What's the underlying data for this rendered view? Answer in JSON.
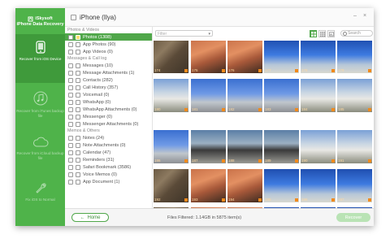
{
  "app": {
    "brand": "iSkysoft",
    "name": "iPhone Data Recovery"
  },
  "sidebar": {
    "modes": [
      {
        "label": "Recover from iOS Device",
        "icon": "phone-icon",
        "active": true
      },
      {
        "label": "Recover from iTunes backup file",
        "icon": "music-note-icon",
        "active": false
      },
      {
        "label": "Recover from iCloud backup file",
        "icon": "cloud-icon",
        "active": false
      },
      {
        "label": "Fix iOS to Normal",
        "icon": "wrench-icon",
        "active": false
      }
    ]
  },
  "header": {
    "device_title": "iPhone (Ilya)"
  },
  "categories": {
    "groups": [
      {
        "title": "Photos & Videos",
        "items": [
          {
            "label": "Photos (1308)",
            "selected": true
          },
          {
            "label": "App Photos (90)",
            "selected": false
          },
          {
            "label": "App Videos (0)",
            "selected": false
          }
        ]
      },
      {
        "title": "Messages & Call log",
        "items": [
          {
            "label": "Messages (10)",
            "selected": false
          },
          {
            "label": "Message Attachments (1)",
            "selected": false
          },
          {
            "label": "Contacts (282)",
            "selected": false
          },
          {
            "label": "Call History (357)",
            "selected": false
          },
          {
            "label": "Voicemail (0)",
            "selected": false
          },
          {
            "label": "WhatsApp (0)",
            "selected": false
          },
          {
            "label": "WhatsApp Attachments (0)",
            "selected": false
          },
          {
            "label": "Messenger (0)",
            "selected": false
          },
          {
            "label": "Messenger Attachments (0)",
            "selected": false
          }
        ]
      },
      {
        "title": "Memos & Others",
        "items": [
          {
            "label": "Notes (24)",
            "selected": false
          },
          {
            "label": "Note Attachments (0)",
            "selected": false
          },
          {
            "label": "Calendar (47)",
            "selected": false
          },
          {
            "label": "Reminders (31)",
            "selected": false
          },
          {
            "label": "Safari Bookmark (3586)",
            "selected": false
          },
          {
            "label": "Voice Memos (0)",
            "selected": false
          },
          {
            "label": "App Document (1)",
            "selected": false
          }
        ]
      }
    ]
  },
  "toolbar": {
    "filter_placeholder": "Filter",
    "search_placeholder": "Search"
  },
  "grid": {
    "tiles": [
      {
        "label": "174",
        "scene": "wood"
      },
      {
        "label": "175",
        "scene": "rock"
      },
      {
        "label": "176",
        "scene": "rock"
      },
      {
        "label": "177",
        "scene": "sky"
      },
      {
        "label": "178",
        "scene": "sky"
      },
      {
        "label": "179",
        "scene": "sky"
      },
      {
        "label": "180",
        "scene": "trailer"
      },
      {
        "label": "181",
        "scene": "city"
      },
      {
        "label": "182",
        "scene": "city"
      },
      {
        "label": "183",
        "scene": "city"
      },
      {
        "label": "184",
        "scene": "trailer"
      },
      {
        "label": "185",
        "scene": "trailer"
      },
      {
        "label": "186",
        "scene": "city"
      },
      {
        "label": "187",
        "scene": "car"
      },
      {
        "label": "188",
        "scene": "car"
      },
      {
        "label": "189",
        "scene": "car"
      },
      {
        "label": "190",
        "scene": "trailer"
      },
      {
        "label": "191",
        "scene": "trailer"
      },
      {
        "label": "192",
        "scene": "wood"
      },
      {
        "label": "193",
        "scene": "rock"
      },
      {
        "label": "194",
        "scene": "rock"
      },
      {
        "label": "195",
        "scene": "sky"
      },
      {
        "label": "196",
        "scene": "sky"
      },
      {
        "label": "197",
        "scene": "sky"
      },
      {
        "label": "",
        "scene": "wood"
      },
      {
        "label": "",
        "scene": "rock"
      },
      {
        "label": "",
        "scene": "rock"
      },
      {
        "label": "",
        "scene": "sky"
      },
      {
        "label": "",
        "scene": "sky"
      },
      {
        "label": "",
        "scene": "sky"
      }
    ]
  },
  "footer": {
    "home_label": "Home",
    "files_text": "Files Filtered: 1.14GB in 5875 item(s)",
    "recover_label": "Recover"
  },
  "colors": {
    "brand_green": "#4fb34a",
    "selected_green": "#50a74a",
    "orange_check": "#f08a1c"
  }
}
